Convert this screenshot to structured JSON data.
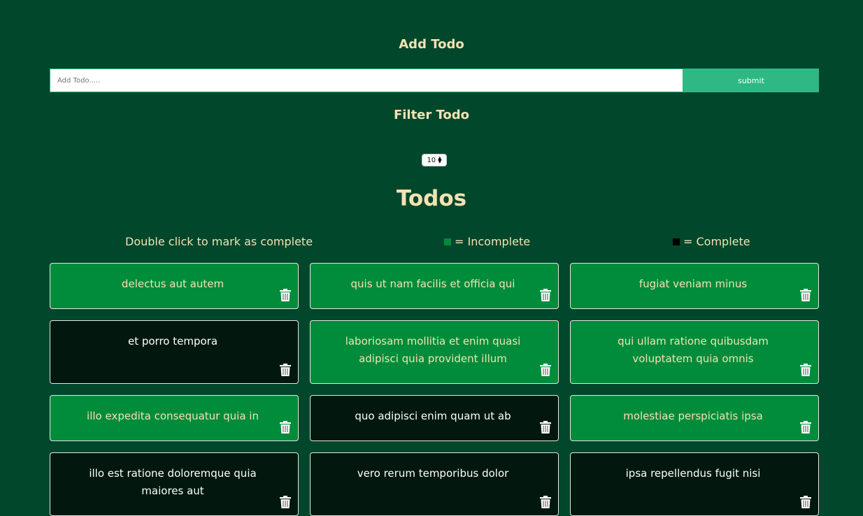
{
  "add_section": {
    "heading": "Add Todo",
    "input_placeholder": "Add Todo.....",
    "submit_label": "submit"
  },
  "filter_section": {
    "heading": "Filter Todo",
    "selected_value": "10"
  },
  "todos_section": {
    "heading": "Todos",
    "hint": "Double click to mark as complete",
    "legend_incomplete": "= Incomplete",
    "legend_complete": "= Complete",
    "items": [
      {
        "title": "delectus aut autem",
        "completed": false
      },
      {
        "title": "quis ut nam facilis et officia qui",
        "completed": false
      },
      {
        "title": "fugiat veniam minus",
        "completed": false
      },
      {
        "title": "et porro tempora",
        "completed": true
      },
      {
        "title": "laboriosam mollitia et enim quasi adipisci quia provident illum",
        "completed": false
      },
      {
        "title": "qui ullam ratione quibusdam voluptatem quia omnis",
        "completed": false
      },
      {
        "title": "illo expedita consequatur quia in",
        "completed": false
      },
      {
        "title": "quo adipisci enim quam ut ab",
        "completed": true
      },
      {
        "title": "molestiae perspiciatis ipsa",
        "completed": false
      },
      {
        "title": "illo est ratione doloremque quia maiores aut",
        "completed": true
      },
      {
        "title": "vero rerum temporibus dolor",
        "completed": true
      },
      {
        "title": "ipsa repellendus fugit nisi",
        "completed": true
      }
    ]
  },
  "colors": {
    "background": "#00472b",
    "accent": "#2fb884",
    "heading_text": "#f4e2b4",
    "incomplete": "#008c3a",
    "complete": "#02180e"
  },
  "icons": {
    "delete": "trash-icon"
  }
}
